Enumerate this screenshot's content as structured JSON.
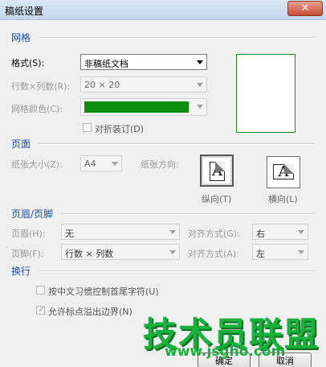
{
  "window": {
    "title": "稿纸设置",
    "close_symbol": "✕"
  },
  "grid_section": {
    "heading": "网格",
    "style_label": "格式(S):",
    "style_value": "非稿纸文档",
    "rows_cols_label": "行数×列数(R):",
    "rows_cols_value": "20 × 20",
    "grid_color_label": "网格颜色(C):",
    "grid_color": "#0b8d0b",
    "fold_checkbox_label": "对折装订(D)",
    "fold_checked": false
  },
  "page_section": {
    "heading": "页面",
    "paper_size_label": "纸张大小(Z):",
    "paper_size_value": "A4",
    "orientation_label": "纸张方向:",
    "portrait_label": "纵向(T)",
    "landscape_label": "横向(L)",
    "icon_letter": "A"
  },
  "header_footer_section": {
    "heading": "页眉/页脚",
    "header_label": "页眉(H):",
    "header_value": "无",
    "header_align_label": "对齐方式(G):",
    "header_align_value": "右",
    "footer_label": "页脚(F):",
    "footer_value": "行数 × 列数",
    "footer_align_label": "对齐方式(A):",
    "footer_align_value": "左"
  },
  "line_break_section": {
    "heading": "换行",
    "option1_label": "按中文习惯控制首尾字符(U)",
    "option1_checked": false,
    "option2_label": "允许标点溢出边界(N)",
    "option2_checked": true
  },
  "buttons": {
    "ok_label": "确定",
    "cancel_label": "取消"
  },
  "watermark": {
    "text": "技术员联盟",
    "url": "www.jsgho.com"
  }
}
